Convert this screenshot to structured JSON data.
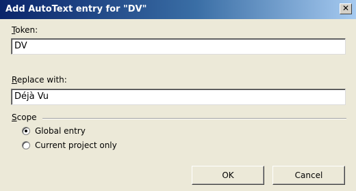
{
  "dialog": {
    "title": "Add AutoText entry for \"DV\"",
    "close_glyph": "✕"
  },
  "token": {
    "label_accel": "T",
    "label_rest": "oken:",
    "value": "DV"
  },
  "replace": {
    "label_accel": "R",
    "label_rest": "eplace with:",
    "value": "Déjà Vu"
  },
  "scope": {
    "label_accel": "S",
    "label_rest": "cope",
    "options": [
      {
        "label": "Global entry",
        "checked": true
      },
      {
        "label": "Current project only",
        "checked": false
      }
    ]
  },
  "buttons": {
    "ok": "OK",
    "cancel": "Cancel"
  }
}
